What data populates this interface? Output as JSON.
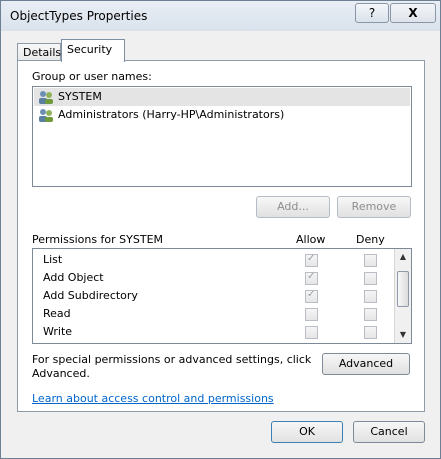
{
  "window": {
    "title": "ObjectTypes Properties",
    "help_label": "?",
    "close_label": "X"
  },
  "tabs": [
    {
      "label": "Details"
    },
    {
      "label": "Security"
    }
  ],
  "security": {
    "group_label": "Group or user names:",
    "users": [
      {
        "name": "SYSTEM",
        "selected": true
      },
      {
        "name": "Administrators (Harry-HP\\Administrators)",
        "selected": false
      }
    ],
    "add_button": "Add...",
    "remove_button": "Remove",
    "permissions_label": "Permissions for SYSTEM",
    "allow_header": "Allow",
    "deny_header": "Deny",
    "permissions": [
      {
        "name": "List",
        "allow": true,
        "deny": false
      },
      {
        "name": "Add Object",
        "allow": true,
        "deny": false
      },
      {
        "name": "Add Subdirectory",
        "allow": true,
        "deny": false
      },
      {
        "name": "Read",
        "allow": false,
        "deny": false
      },
      {
        "name": "Write",
        "allow": false,
        "deny": false
      }
    ],
    "special_text_1": "For special permissions or advanced settings, click",
    "special_text_2": "Advanced.",
    "advanced_button": "Advanced",
    "learn_link": "Learn about access control and permissions"
  },
  "footer": {
    "ok_button": "OK",
    "cancel_button": "Cancel"
  },
  "colors": {
    "link": "#0066cc",
    "selection": "#e4e4e4"
  }
}
